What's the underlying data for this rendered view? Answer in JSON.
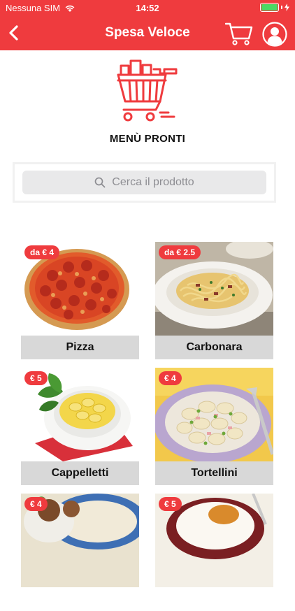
{
  "status": {
    "carrier": "Nessuna SIM",
    "time": "14:52",
    "battery_level": 1.0
  },
  "navbar": {
    "title": "Spesa Veloce"
  },
  "page": {
    "heading": "MENÙ PRONTI"
  },
  "search": {
    "placeholder": "Cerca il prodotto"
  },
  "products": [
    {
      "name": "Pizza",
      "price": "da € 4"
    },
    {
      "name": "Carbonara",
      "price": "da € 2.5"
    },
    {
      "name": "Cappelletti",
      "price": "€ 5"
    },
    {
      "name": "Tortellini",
      "price": "€ 4"
    },
    {
      "name": "",
      "price": "€ 4"
    },
    {
      "name": "",
      "price": "€ 5"
    }
  ],
  "colors": {
    "brand_red": "#ef3b3e",
    "label_gray": "#d8d8d8",
    "search_gray": "#e9e9ea"
  }
}
